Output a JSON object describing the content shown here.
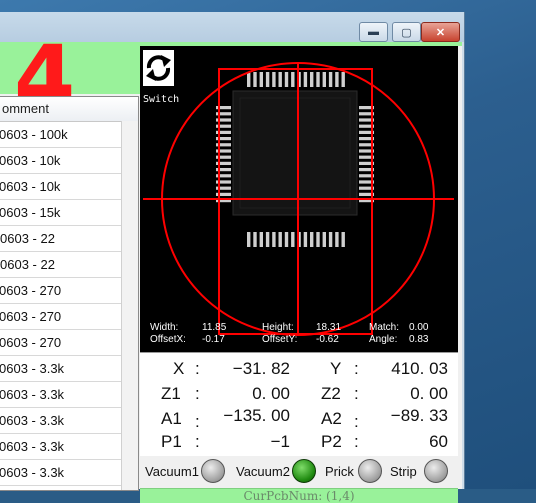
{
  "window": {
    "controls": {
      "minimize": "▬",
      "maximize": "▢",
      "close": "✕"
    }
  },
  "header": {
    "number": "4"
  },
  "grid": {
    "column_header": "omment",
    "rows": [
      "0603 - 100k",
      "0603 - 10k",
      "0603 - 10k",
      "0603 - 15k",
      "0603 - 22",
      "0603 - 22",
      "0603 - 270",
      "0603 - 270",
      "0603 - 270",
      "0603 - 3.3k",
      "0603 - 3.3k",
      "0603 - 3.3k",
      "0603 - 3.3k",
      "0603 - 3.3k"
    ]
  },
  "camera": {
    "switch_label": "Switch",
    "width_label": "Width:",
    "width_value": "11.85",
    "height_label": "Height:",
    "height_value": "18.31",
    "match_label": "Match:",
    "match_value": "0.00",
    "offsetx_label": "OffsetX:",
    "offsetx_value": "-0.17",
    "offsety_label": "OffsetY:",
    "offsety_value": "-0.62",
    "angle_label": "Angle:",
    "angle_value": "0.83"
  },
  "coords": {
    "x_label": "X",
    "x_value": "−31. 82",
    "y_label": "Y",
    "y_value": "410. 03",
    "z1_label": "Z1",
    "z1_value": "0. 00",
    "z2_label": "Z2",
    "z2_value": "0. 00",
    "a1_label": "A1",
    "a1_value": "−135. 00",
    "a2_label": "A2",
    "a2_value": "−89. 33",
    "p1_label": "P1",
    "p1_value": "−1",
    "p2_label": "P2",
    "p2_value": "60",
    "colon": ":"
  },
  "toggles": {
    "vacuum1": {
      "label": "Vacuum1",
      "on": false
    },
    "vacuum2": {
      "label": "Vacuum2",
      "on": true
    },
    "prick": {
      "label": "Prick",
      "on": false
    },
    "strip": {
      "label": "Strip",
      "on": false
    }
  },
  "status": {
    "text": "CurPcbNum: (1,4)"
  },
  "colors": {
    "accent_green": "#99f29a",
    "crosshair": "#ff0000",
    "big_number": "#ff1a1a"
  }
}
